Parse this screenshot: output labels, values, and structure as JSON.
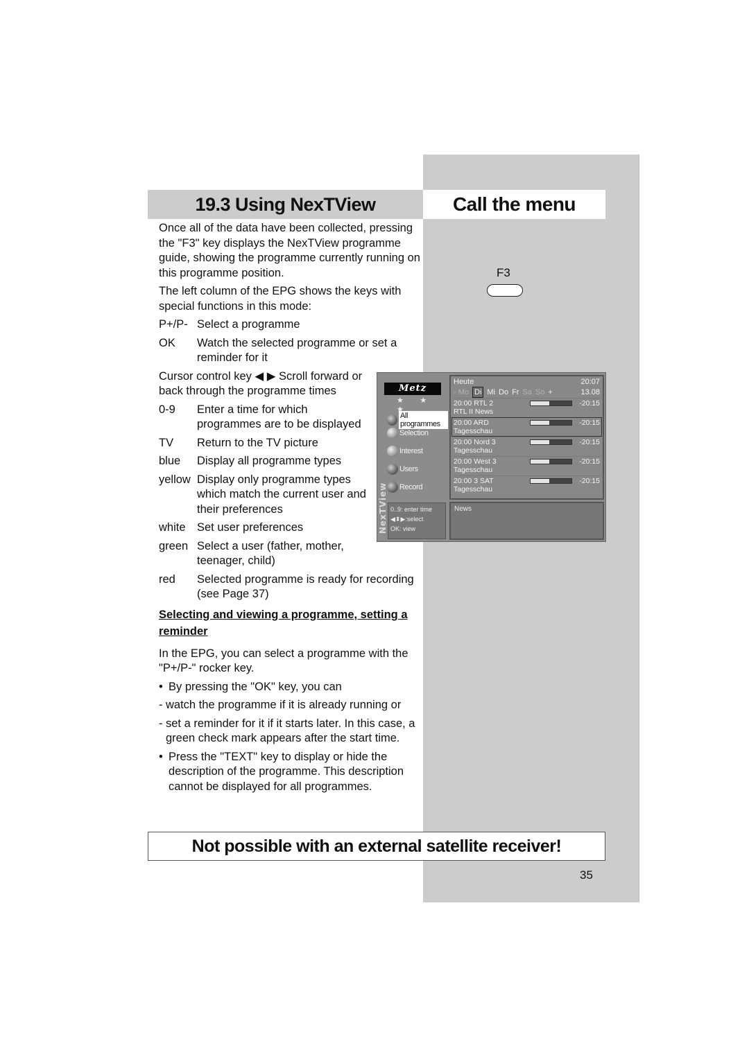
{
  "header": {
    "section_title": "19.3 Using NexTView",
    "side_title": "Call the menu"
  },
  "intro": [
    "Once all of the data have been collected, pressing the \"F3\" key displays the NexTView programme guide, showing the programme currently running on this programme position.",
    "The left column of the EPG shows the keys with special functions in this mode:"
  ],
  "keys_top": [
    {
      "key": "P+/P-",
      "desc": "Select a programme"
    },
    {
      "key": "OK",
      "desc": "Watch the selected programme or set a reminder for it"
    }
  ],
  "cursor_text": "Cursor control key ◀ ▶ Scroll forward or back through the programme times",
  "keys_bottom": [
    {
      "key": "0-9",
      "desc": "Enter a time for which programmes are to be displayed"
    },
    {
      "key": "TV",
      "desc": "Return to the TV picture"
    },
    {
      "key": "blue",
      "desc": "Display all programme types"
    },
    {
      "key": "yellow",
      "desc": "Display only programme types which match the current user and their preferences"
    },
    {
      "key": "white",
      "desc": "Set user preferences"
    },
    {
      "key": "green",
      "desc": "Select a user (father, mother, teenager, child)"
    },
    {
      "key": "red",
      "desc": "Selected programme is ready for recording (see Page 37)"
    }
  ],
  "subsection": {
    "heading": "Selecting and viewing a programme, setting a reminder",
    "para": "In the EPG, you can select a programme with the \"P+/P-\" rocker key.",
    "bullet1": "By pressing the \"OK\" key, you can",
    "dash1": "watch the programme if it is already running or",
    "dash2": "set a reminder for it if it starts later. In this case, a green check mark appears after the start time.",
    "bullet2": "Press the \"TEXT\" key to display or hide the description of the programme. This description cannot be displayed for all programmes."
  },
  "side": {
    "key_label": "F3",
    "key_icon": "remote-key-icon"
  },
  "epg": {
    "logo": "Metz",
    "stars": "★ ★ ★",
    "menu": [
      {
        "label": "All programmes",
        "active": true
      },
      {
        "label": "Selection",
        "active": false
      },
      {
        "label": "Interest",
        "active": false
      },
      {
        "label": "Users",
        "active": false
      },
      {
        "label": "Record",
        "active": false
      }
    ],
    "vertical_label": "NexTView",
    "help": [
      "0..9: enter time",
      "◀⬍▶:select",
      "OK: view"
    ],
    "today": "Heute",
    "clock": "20:07",
    "days": [
      {
        "label": "- Mo",
        "state": "dim"
      },
      {
        "label": "Di",
        "state": "sel"
      },
      {
        "label": "Mi",
        "state": "normal"
      },
      {
        "label": "Do",
        "state": "normal"
      },
      {
        "label": "Fr",
        "state": "normal"
      },
      {
        "label": "Sa",
        "state": "dim"
      },
      {
        "label": "So",
        "state": "dim"
      },
      {
        "label": "+",
        "state": "normal"
      }
    ],
    "date": "13.08",
    "programmes": [
      {
        "time_channel": "20:00 RTL 2",
        "title": "RTL II News",
        "end": "-20:15",
        "progress": 0.45,
        "selected": false
      },
      {
        "time_channel": "20:00 ARD",
        "title": "Tagesschau",
        "end": "-20:15",
        "progress": 0.45,
        "selected": true
      },
      {
        "time_channel": "20:00 Nord 3",
        "title": "Tagesschau",
        "end": "-20:15",
        "progress": 0.45,
        "selected": false
      },
      {
        "time_channel": "20:00 West 3",
        "title": "Tagesschau",
        "end": "-20:15",
        "progress": 0.45,
        "selected": false
      },
      {
        "time_channel": "20:00 3 SAT",
        "title": "Tagesschau",
        "end": "-20:15",
        "progress": 0.45,
        "selected": false
      }
    ],
    "description": "News"
  },
  "warning": "Not possible with an external satellite receiver!",
  "page_number": "35"
}
